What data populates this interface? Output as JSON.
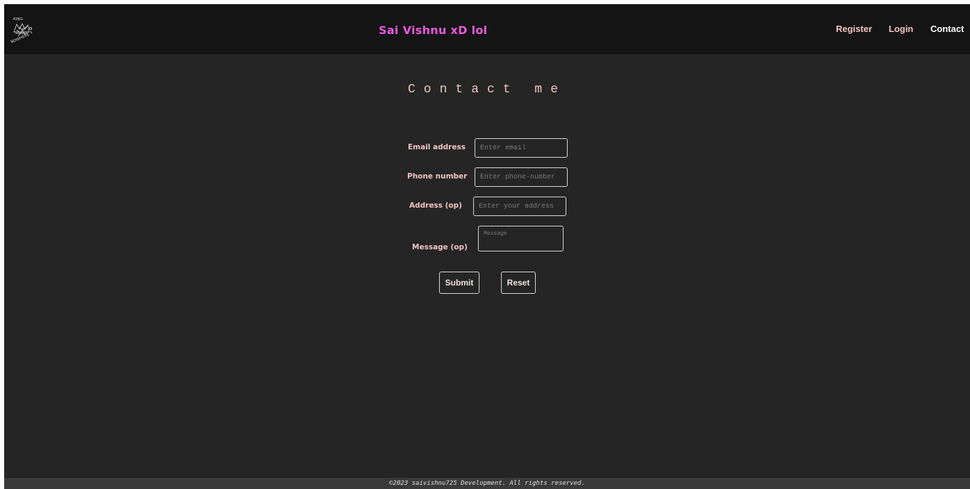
{
  "navbar": {
    "logo": {
      "icon": "king-nowhere-logo-icon",
      "text_top": "·KING·",
      "text_bottom": "NOWHERE"
    },
    "brand": "Sai Vishnu xD lol",
    "links": [
      {
        "label": "Register",
        "active": false
      },
      {
        "label": "Login",
        "active": false
      },
      {
        "label": "Contact",
        "active": true
      }
    ]
  },
  "page": {
    "title": "Contact me"
  },
  "form": {
    "email": {
      "label": "Email address",
      "placeholder": "Enter email",
      "value": ""
    },
    "phone": {
      "label": "Phone number",
      "placeholder": "Enter phone-number",
      "value": ""
    },
    "address": {
      "label": "Address (op)",
      "placeholder": "Enter your address",
      "value": ""
    },
    "message": {
      "label": "Message (op)",
      "placeholder": "Message",
      "value": ""
    },
    "submit_label": "Submit",
    "reset_label": "Reset"
  },
  "footer": {
    "text": "©2023 saivishnu725 Development. All rights reserved."
  },
  "colors": {
    "page_background": "#252525",
    "navbar_background": "#141414",
    "brand_accent": "#ec56e0",
    "label_pink": "#f0c4c0",
    "footer_background": "#3a3a3a"
  }
}
